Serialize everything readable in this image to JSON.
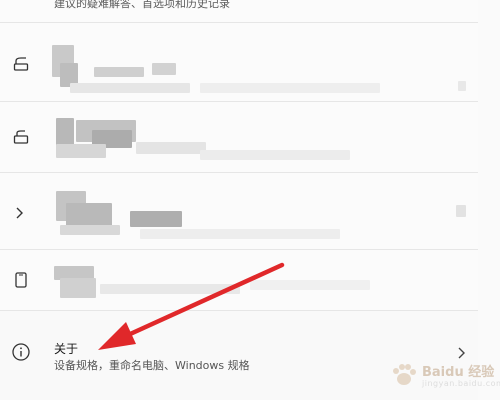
{
  "top_item": {
    "desc": "建议的疑难解答、首选项和历史记录"
  },
  "about": {
    "title": "关于",
    "desc": "设备规格，重命名电脑、Windows 规格"
  },
  "icons": {
    "row1": "shield-lock-icon",
    "row2": "cloud-sync-icon",
    "row3": "terminal-icon",
    "row4": "phone-device-icon",
    "about": "info-icon",
    "chevron": "chevron-right-icon"
  },
  "colors": {
    "annotation_arrow": "#e0282a",
    "row_bg": "#fbfbfb",
    "page_bg": "#f3f3f3"
  },
  "watermark": {
    "brand": "Baidu 经验",
    "sub": "jingyan.baidu.com"
  }
}
